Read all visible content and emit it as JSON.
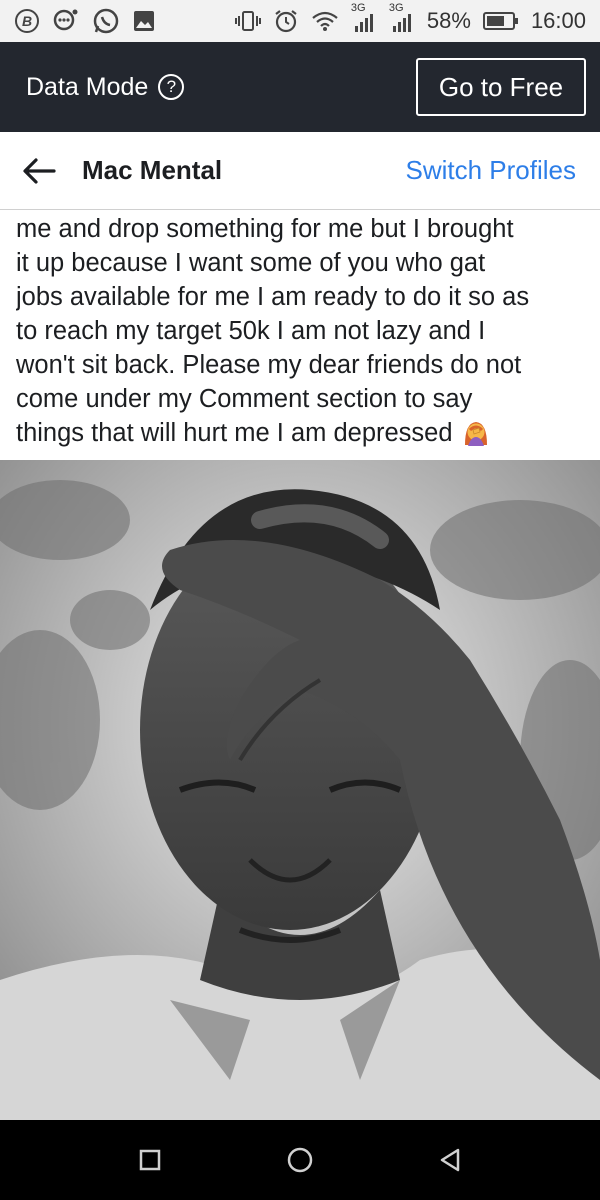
{
  "status_bar": {
    "time": "16:00",
    "battery_percent": "58%",
    "network_label_1": "3G",
    "network_label_2": "3G",
    "icons": [
      "b-icon",
      "chat-bubble-icon",
      "whatsapp-icon",
      "gallery-icon",
      "vibrate-icon",
      "alarm-icon",
      "wifi-icon",
      "signal-icon",
      "signal-icon",
      "battery-icon"
    ]
  },
  "data_mode_bar": {
    "label": "Data Mode",
    "help_symbol": "?",
    "go_free_label": "Go to Free"
  },
  "profile_header": {
    "name": "Mac Mental",
    "switch_label": "Switch Profiles"
  },
  "post": {
    "lines": [
      "me and drop something for me but I brought",
      "it up because I want some of you who gat",
      "jobs available for me I am ready to do it so as",
      "to reach my target 50k I am not lazy and I",
      "won't sit back. Please my dear friends do not",
      "come under my Comment section to say",
      "things that will hurt me I am depressed"
    ],
    "trailing_emoji": "woman-facepalming-icon"
  },
  "photo": {
    "subject": "person-photo"
  },
  "nav_bar": {
    "icons": [
      "recents-square-icon",
      "home-circle-icon",
      "back-triangle-icon"
    ]
  },
  "colors": {
    "data_mode_bg": "#23272f",
    "link_blue": "#2d7ee8",
    "text": "#1c1e21"
  }
}
